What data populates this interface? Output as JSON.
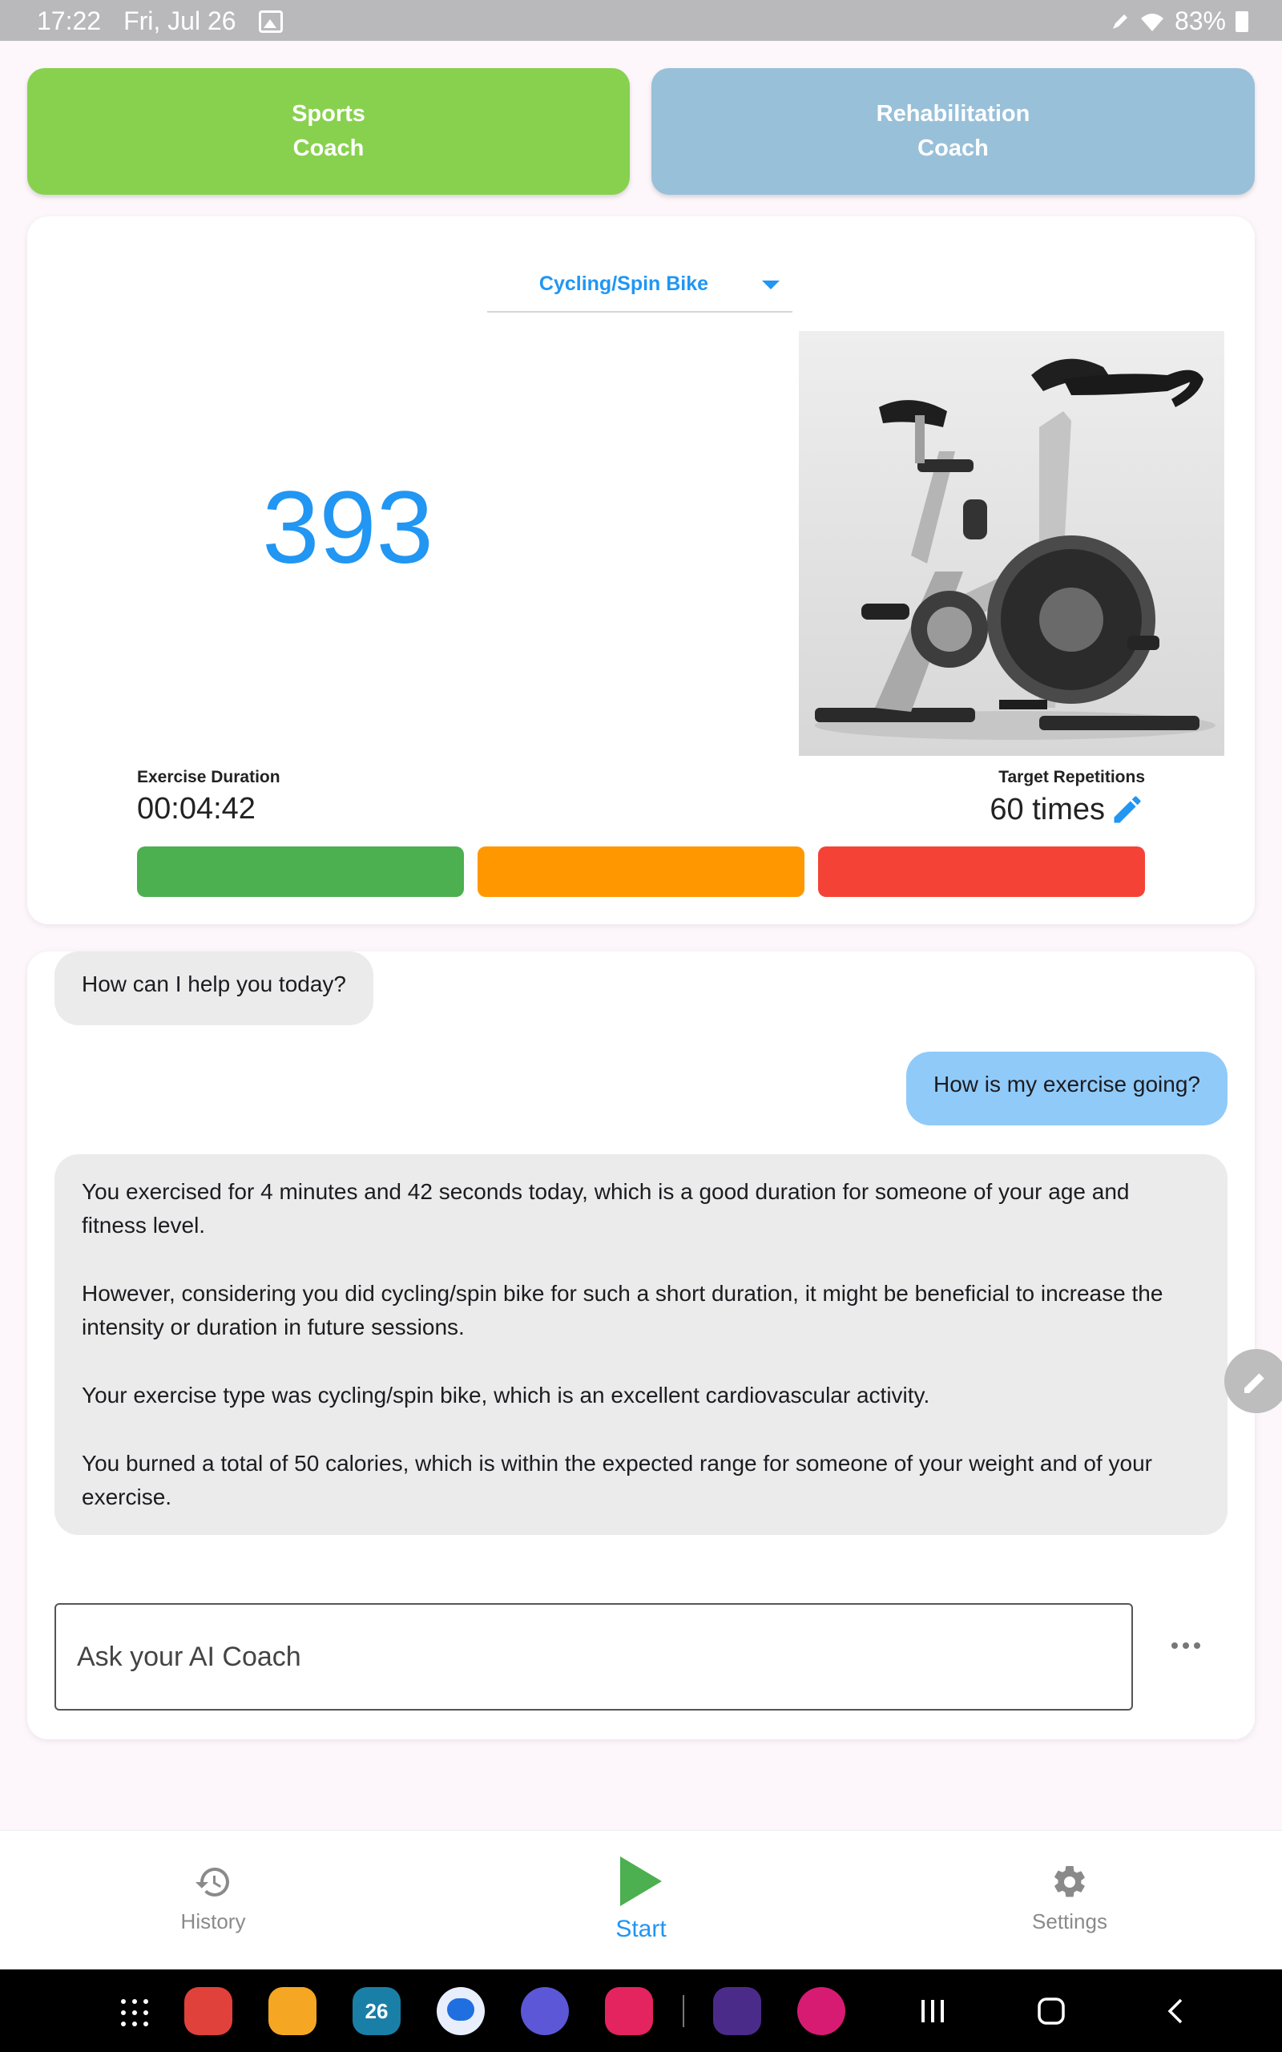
{
  "status_bar": {
    "time": "17:22",
    "date": "Fri, Jul 26",
    "battery": "83%"
  },
  "coaches": [
    {
      "label": "Sports\nCoach",
      "color": "#88d14f"
    },
    {
      "label": "Rehabilitation\nCoach",
      "color": "#98c0d9"
    }
  ],
  "exercise": {
    "type": "Cycling/Spin Bike",
    "count": "393",
    "duration_label": "Exercise Duration",
    "duration_value": "00:04:42",
    "target_label": "Target Repetitions",
    "target_value": "60 times",
    "image": "spin-bike-photo",
    "bar_colors": [
      "#4caf50",
      "#ff9800",
      "#f44336"
    ]
  },
  "chat": {
    "messages": [
      {
        "role": "ai",
        "text": "How can I help you today?"
      },
      {
        "role": "user",
        "text": "How is my exercise going?"
      },
      {
        "role": "ai",
        "paragraphs": [
          "You exercised for 4 minutes and 42 seconds today, which is a good duration for someone of your age and fitness level.",
          "However, considering you did cycling/spin bike for such a short duration, it might be beneficial to increase the intensity or duration in future sessions.",
          "Your exercise type was cycling/spin bike, which is an excellent cardiovascular activity.",
          "You burned a total of 50 calories, which is within the expected range for someone of your weight and of your exercise."
        ]
      }
    ],
    "input_placeholder": "Ask your AI Coach"
  },
  "bottom_nav": {
    "history": "History",
    "start": "Start",
    "settings": "Settings"
  },
  "accent_color": "#2196f3"
}
